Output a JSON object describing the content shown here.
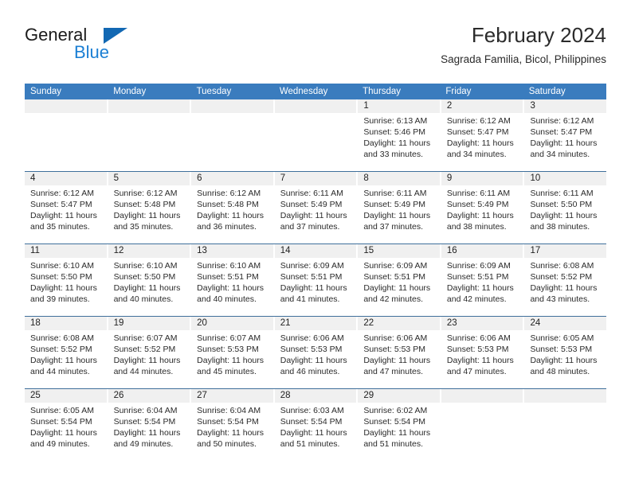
{
  "brand": {
    "name_dark": "General",
    "name_blue": "Blue",
    "accent_color": "#1268b3",
    "blue_text_color": "#1b7fd4"
  },
  "header": {
    "title": "February 2024",
    "subtitle": "Sagrada Familia, Bicol, Philippines"
  },
  "calendar": {
    "header_bg": "#3a7cbe",
    "row_separator_color": "#3f6f9b",
    "day_number_bg": "#f0f0f0",
    "weekdays": [
      "Sunday",
      "Monday",
      "Tuesday",
      "Wednesday",
      "Thursday",
      "Friday",
      "Saturday"
    ],
    "weeks": [
      [
        {
          "day": "",
          "sunrise": "",
          "sunset": "",
          "daylight": ""
        },
        {
          "day": "",
          "sunrise": "",
          "sunset": "",
          "daylight": ""
        },
        {
          "day": "",
          "sunrise": "",
          "sunset": "",
          "daylight": ""
        },
        {
          "day": "",
          "sunrise": "",
          "sunset": "",
          "daylight": ""
        },
        {
          "day": "1",
          "sunrise": "Sunrise: 6:13 AM",
          "sunset": "Sunset: 5:46 PM",
          "daylight": "Daylight: 11 hours and 33 minutes."
        },
        {
          "day": "2",
          "sunrise": "Sunrise: 6:12 AM",
          "sunset": "Sunset: 5:47 PM",
          "daylight": "Daylight: 11 hours and 34 minutes."
        },
        {
          "day": "3",
          "sunrise": "Sunrise: 6:12 AM",
          "sunset": "Sunset: 5:47 PM",
          "daylight": "Daylight: 11 hours and 34 minutes."
        }
      ],
      [
        {
          "day": "4",
          "sunrise": "Sunrise: 6:12 AM",
          "sunset": "Sunset: 5:47 PM",
          "daylight": "Daylight: 11 hours and 35 minutes."
        },
        {
          "day": "5",
          "sunrise": "Sunrise: 6:12 AM",
          "sunset": "Sunset: 5:48 PM",
          "daylight": "Daylight: 11 hours and 35 minutes."
        },
        {
          "day": "6",
          "sunrise": "Sunrise: 6:12 AM",
          "sunset": "Sunset: 5:48 PM",
          "daylight": "Daylight: 11 hours and 36 minutes."
        },
        {
          "day": "7",
          "sunrise": "Sunrise: 6:11 AM",
          "sunset": "Sunset: 5:49 PM",
          "daylight": "Daylight: 11 hours and 37 minutes."
        },
        {
          "day": "8",
          "sunrise": "Sunrise: 6:11 AM",
          "sunset": "Sunset: 5:49 PM",
          "daylight": "Daylight: 11 hours and 37 minutes."
        },
        {
          "day": "9",
          "sunrise": "Sunrise: 6:11 AM",
          "sunset": "Sunset: 5:49 PM",
          "daylight": "Daylight: 11 hours and 38 minutes."
        },
        {
          "day": "10",
          "sunrise": "Sunrise: 6:11 AM",
          "sunset": "Sunset: 5:50 PM",
          "daylight": "Daylight: 11 hours and 38 minutes."
        }
      ],
      [
        {
          "day": "11",
          "sunrise": "Sunrise: 6:10 AM",
          "sunset": "Sunset: 5:50 PM",
          "daylight": "Daylight: 11 hours and 39 minutes."
        },
        {
          "day": "12",
          "sunrise": "Sunrise: 6:10 AM",
          "sunset": "Sunset: 5:50 PM",
          "daylight": "Daylight: 11 hours and 40 minutes."
        },
        {
          "day": "13",
          "sunrise": "Sunrise: 6:10 AM",
          "sunset": "Sunset: 5:51 PM",
          "daylight": "Daylight: 11 hours and 40 minutes."
        },
        {
          "day": "14",
          "sunrise": "Sunrise: 6:09 AM",
          "sunset": "Sunset: 5:51 PM",
          "daylight": "Daylight: 11 hours and 41 minutes."
        },
        {
          "day": "15",
          "sunrise": "Sunrise: 6:09 AM",
          "sunset": "Sunset: 5:51 PM",
          "daylight": "Daylight: 11 hours and 42 minutes."
        },
        {
          "day": "16",
          "sunrise": "Sunrise: 6:09 AM",
          "sunset": "Sunset: 5:51 PM",
          "daylight": "Daylight: 11 hours and 42 minutes."
        },
        {
          "day": "17",
          "sunrise": "Sunrise: 6:08 AM",
          "sunset": "Sunset: 5:52 PM",
          "daylight": "Daylight: 11 hours and 43 minutes."
        }
      ],
      [
        {
          "day": "18",
          "sunrise": "Sunrise: 6:08 AM",
          "sunset": "Sunset: 5:52 PM",
          "daylight": "Daylight: 11 hours and 44 minutes."
        },
        {
          "day": "19",
          "sunrise": "Sunrise: 6:07 AM",
          "sunset": "Sunset: 5:52 PM",
          "daylight": "Daylight: 11 hours and 44 minutes."
        },
        {
          "day": "20",
          "sunrise": "Sunrise: 6:07 AM",
          "sunset": "Sunset: 5:53 PM",
          "daylight": "Daylight: 11 hours and 45 minutes."
        },
        {
          "day": "21",
          "sunrise": "Sunrise: 6:06 AM",
          "sunset": "Sunset: 5:53 PM",
          "daylight": "Daylight: 11 hours and 46 minutes."
        },
        {
          "day": "22",
          "sunrise": "Sunrise: 6:06 AM",
          "sunset": "Sunset: 5:53 PM",
          "daylight": "Daylight: 11 hours and 47 minutes."
        },
        {
          "day": "23",
          "sunrise": "Sunrise: 6:06 AM",
          "sunset": "Sunset: 5:53 PM",
          "daylight": "Daylight: 11 hours and 47 minutes."
        },
        {
          "day": "24",
          "sunrise": "Sunrise: 6:05 AM",
          "sunset": "Sunset: 5:53 PM",
          "daylight": "Daylight: 11 hours and 48 minutes."
        }
      ],
      [
        {
          "day": "25",
          "sunrise": "Sunrise: 6:05 AM",
          "sunset": "Sunset: 5:54 PM",
          "daylight": "Daylight: 11 hours and 49 minutes."
        },
        {
          "day": "26",
          "sunrise": "Sunrise: 6:04 AM",
          "sunset": "Sunset: 5:54 PM",
          "daylight": "Daylight: 11 hours and 49 minutes."
        },
        {
          "day": "27",
          "sunrise": "Sunrise: 6:04 AM",
          "sunset": "Sunset: 5:54 PM",
          "daylight": "Daylight: 11 hours and 50 minutes."
        },
        {
          "day": "28",
          "sunrise": "Sunrise: 6:03 AM",
          "sunset": "Sunset: 5:54 PM",
          "daylight": "Daylight: 11 hours and 51 minutes."
        },
        {
          "day": "29",
          "sunrise": "Sunrise: 6:02 AM",
          "sunset": "Sunset: 5:54 PM",
          "daylight": "Daylight: 11 hours and 51 minutes."
        },
        {
          "day": "",
          "sunrise": "",
          "sunset": "",
          "daylight": ""
        },
        {
          "day": "",
          "sunrise": "",
          "sunset": "",
          "daylight": ""
        }
      ]
    ]
  }
}
